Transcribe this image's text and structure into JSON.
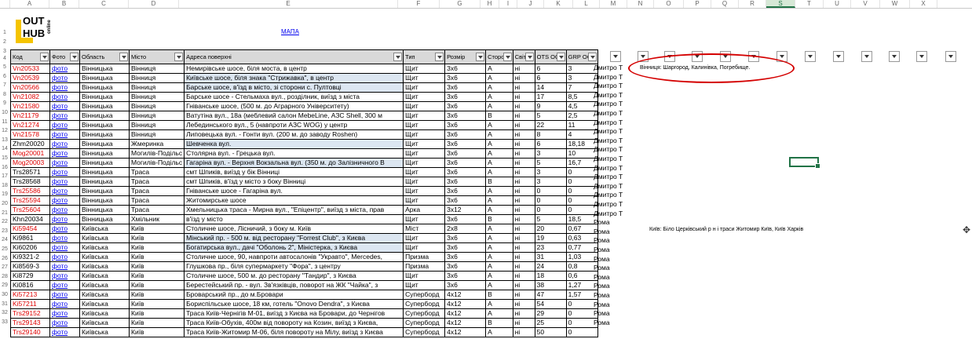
{
  "columns": [
    "A",
    "B",
    "C",
    "D",
    "E",
    "F",
    "G",
    "H",
    "I",
    "J",
    "K",
    "L",
    "M",
    "N",
    "O",
    "P",
    "Q",
    "R",
    "S",
    "T",
    "U",
    "V",
    "W",
    "X"
  ],
  "selected_column": "S",
  "logo": {
    "line1": "OUT",
    "line2": "HUB",
    "line3": "online"
  },
  "mapa_link": "МАПА",
  "headers": [
    "Код",
    "Фото",
    "Область",
    "Місто",
    "Адреса поверхні",
    "Тип",
    "Розмір",
    "Сторона",
    "Світло",
    "OTS OOO",
    "GRP OOO"
  ],
  "rows": [
    {
      "n": "5",
      "code": "Vn20533",
      "red": true,
      "photo": "фото",
      "oblast": "Вінницька",
      "city": "Вінниця",
      "addr": "Немирівське шосе, біля моста, в центр",
      "hl": false,
      "type": "Щит",
      "size": "3х6",
      "side": "A",
      "light": "ні",
      "ots": "6",
      "grp": "3",
      "extra": "Дмитро Т"
    },
    {
      "n": "6",
      "code": "Vn20539",
      "red": true,
      "photo": "фото",
      "oblast": "Вінницька",
      "city": "Вінниця",
      "addr": "Київське шосе, біля знака \"Стрижавка\", в центр",
      "hl": true,
      "type": "Щит",
      "size": "3х6",
      "side": "A",
      "light": "ні",
      "ots": "6",
      "grp": "3",
      "extra": "Дмитро Т"
    },
    {
      "n": "7",
      "code": "Vn20566",
      "red": true,
      "photo": "фото",
      "oblast": "Вінницька",
      "city": "Вінниця",
      "addr": "Барське шосе, в'їзд в місто, зі сторони с. Пултовці",
      "hl": true,
      "type": "Щит",
      "size": "3х6",
      "side": "A",
      "light": "ні",
      "ots": "14",
      "grp": "7",
      "extra": "Дмитро Т"
    },
    {
      "n": "8",
      "code": "Vn21082",
      "red": true,
      "photo": "фото",
      "oblast": "Вінницька",
      "city": "Вінниця",
      "addr": "Барське шосе - Стельмаха вул., розділник, виїзд з міста",
      "hl": false,
      "type": "Щит",
      "size": "3х6",
      "side": "A",
      "light": "ні",
      "ots": "17",
      "grp": "8,5",
      "extra": "Дмитро Т"
    },
    {
      "n": "9",
      "code": "Vn21580",
      "red": true,
      "photo": "фото",
      "oblast": "Вінницька",
      "city": "Вінниця",
      "addr": "Гніванське шосе, (500 м. до Аграрного Університету)",
      "hl": false,
      "type": "Щит",
      "size": "3х6",
      "side": "A",
      "light": "ні",
      "ots": "9",
      "grp": "4,5",
      "extra": "Дмитро Т"
    },
    {
      "n": "10",
      "code": "Vn21179",
      "red": true,
      "photo": "фото",
      "oblast": "Вінницька",
      "city": "Вінниця",
      "addr": "Ватутіна вул., 18а (меблевий салон MebeLine, АЗС Shell, 300 м",
      "hl": false,
      "type": "Щит",
      "size": "3х6",
      "side": "B",
      "light": "ні",
      "ots": "5",
      "grp": "2,5",
      "extra": "Дмитро Т"
    },
    {
      "n": "11",
      "code": "Vn21274",
      "red": true,
      "photo": "фото",
      "oblast": "Вінницька",
      "city": "Вінниця",
      "addr": "Лебединського вул., 5 (навпроти АЗС WOG) у центр",
      "hl": false,
      "type": "Щит",
      "size": "3х6",
      "side": "A",
      "light": "ні",
      "ots": "22",
      "grp": "11",
      "extra": "Дмитро Т"
    },
    {
      "n": "12",
      "code": "Vn21578",
      "red": true,
      "photo": "фото",
      "oblast": "Вінницька",
      "city": "Вінниця",
      "addr": "Липовецька вул. - Гонти вул. (200 м. до заводу Roshen)",
      "hl": false,
      "type": "Щит",
      "size": "3х6",
      "side": "A",
      "light": "ні",
      "ots": "8",
      "grp": "4",
      "extra": "Дмитро Т"
    },
    {
      "n": "13",
      "code": "Zhm20020",
      "red": false,
      "photo": "фото",
      "oblast": "Вінницька",
      "city": "Жмеринка",
      "addr": "Шевченка вул.",
      "hl": true,
      "type": "Щит",
      "size": "3х6",
      "side": "A",
      "light": "ні",
      "ots": "6",
      "grp": "18,18",
      "extra": "Дмитро Т"
    },
    {
      "n": "14",
      "code": "Mog20001",
      "red": true,
      "photo": "фото",
      "oblast": "Вінницька",
      "city": "Могилів-Подільс",
      "addr": "Столярна вул. - Грецька вул.",
      "hl": false,
      "type": "Щит",
      "size": "3х6",
      "side": "A",
      "light": "ні",
      "ots": "3",
      "grp": "10",
      "extra": "Дмитро Т"
    },
    {
      "n": "15",
      "code": "Mog20003",
      "red": true,
      "photo": "фото",
      "oblast": "Вінницька",
      "city": "Могилів-Подільс",
      "addr": "Гагаріна вул. - Верхня Вокзальна вул. (350 м. до Залізничного В",
      "hl": true,
      "type": "Щит",
      "size": "3х6",
      "side": "A",
      "light": "ні",
      "ots": "5",
      "grp": "16,7",
      "extra": "Дмитро Т"
    },
    {
      "n": "16",
      "code": "Trs28571",
      "red": false,
      "photo": "фото",
      "oblast": "Вінницька",
      "city": "Траса",
      "addr": "смт Шпиків, виїзд у бік Вінниці",
      "hl": false,
      "type": "Щит",
      "size": "3х6",
      "side": "A",
      "light": "ні",
      "ots": "3",
      "grp": "0",
      "extra": "Дмитро Т"
    },
    {
      "n": "17",
      "code": "Trs28568",
      "red": false,
      "photo": "фото",
      "oblast": "Вінницька",
      "city": "Траса",
      "addr": "смт Шпиків, в'їзд у місто з боку Вінниці",
      "hl": false,
      "type": "Щит",
      "size": "3х6",
      "side": "B",
      "light": "ні",
      "ots": "3",
      "grp": "0",
      "extra": "Дмитро Т"
    },
    {
      "n": "18",
      "code": "Trs25586",
      "red": true,
      "photo": "фото",
      "oblast": "Вінницька",
      "city": "Траса",
      "addr": "Гніванське шосе - Гагаріна вул.",
      "hl": false,
      "type": "Щит",
      "size": "3х6",
      "side": "A",
      "light": "ні",
      "ots": "0",
      "grp": "0",
      "extra": "Дмитро Т"
    },
    {
      "n": "19",
      "code": "Trs25594",
      "red": true,
      "photo": "фото",
      "oblast": "Вінницька",
      "city": "Траса",
      "addr": "Житомирське шосе",
      "hl": false,
      "type": "Щит",
      "size": "3х6",
      "side": "A",
      "light": "ні",
      "ots": "0",
      "grp": "0",
      "extra": "Дмитро Т"
    },
    {
      "n": "20",
      "code": "Trs25604",
      "red": true,
      "photo": "фото",
      "oblast": "Вінницька",
      "city": "Траса",
      "addr": "Хмельницька траса - Мирна вул., \"Епіцентр\", виїзд з міста, прав",
      "hl": false,
      "type": "Арка",
      "size": "3х12",
      "side": "A",
      "light": "ні",
      "ots": "0",
      "grp": "0",
      "extra": "Дмитро Т"
    },
    {
      "n": "21",
      "code": "Khn20034",
      "red": false,
      "photo": "фото",
      "oblast": "Вінницька",
      "city": "Хмільник",
      "addr": "в'їзд у місто",
      "hl": false,
      "type": "Щит",
      "size": "3х6",
      "side": "B",
      "light": "ні",
      "ots": "5",
      "grp": "18,5",
      "extra": "Дмитро Т"
    },
    {
      "n": "22",
      "code": "Ki59454",
      "red": true,
      "photo": "фото",
      "oblast": "Київська",
      "city": "Київ",
      "addr": "Столичне шосе, Лісничий, з боку м. Київ",
      "hl": false,
      "type": "Міст",
      "size": "2х8",
      "side": "A",
      "light": "ні",
      "ots": "20",
      "grp": "0,67",
      "extra": "Рома"
    },
    {
      "n": "23",
      "code": "Ki9861",
      "red": false,
      "photo": "фото",
      "oblast": "Київська",
      "city": "Київ",
      "addr": "Мінський пр. - 500 м. від ресторану \"Forrest Club\", з Києва",
      "hl": true,
      "type": "Щит",
      "size": "3х6",
      "side": "A",
      "light": "ні",
      "ots": "19",
      "grp": "0,63",
      "extra": "Рома"
    },
    {
      "n": "24",
      "code": "Ki60206",
      "red": false,
      "photo": "фото",
      "oblast": "Київська",
      "city": "Київ",
      "addr": "Богатирська вул., дачі \"Оболонь 2\", Міністерка, з Києва",
      "hl": true,
      "type": "Щит",
      "size": "3х6",
      "side": "A",
      "light": "ні",
      "ots": "23",
      "grp": "0,77",
      "extra": "Рома"
    },
    {
      "n": "25",
      "code": "Ki9321-2",
      "red": false,
      "photo": "фото",
      "oblast": "Київська",
      "city": "Київ",
      "addr": "Столичне шосе, 90, навпроти автосалонів \"Укравто\", Mercedes,",
      "hl": false,
      "type": "Призма",
      "size": "3х6",
      "side": "A",
      "light": "ні",
      "ots": "31",
      "grp": "1,03",
      "extra": "Рома"
    },
    {
      "n": "26",
      "code": "Ki8569-3",
      "red": false,
      "photo": "фото",
      "oblast": "Київська",
      "city": "Київ",
      "addr": "Глушкова пр., біля супермаркету \"Фора\", з центру",
      "hl": false,
      "type": "Призма",
      "size": "3х6",
      "side": "A",
      "light": "ні",
      "ots": "24",
      "grp": "0,8",
      "extra": "Рома"
    },
    {
      "n": "27",
      "code": "Ki8729",
      "red": false,
      "photo": "фото",
      "oblast": "Київська",
      "city": "Київ",
      "addr": "Столичне шосе, 500 м. до ресторану \"Тандир\", з Києва",
      "hl": false,
      "type": "Щит",
      "size": "3х6",
      "side": "A",
      "light": "ні",
      "ots": "18",
      "grp": "0,6",
      "extra": "Рома"
    },
    {
      "n": "28",
      "code": "Ki0816",
      "red": false,
      "photo": "фото",
      "oblast": "Київська",
      "city": "Київ",
      "addr": "Берестейський пр. - вул. Зв'язківців, поворот на ЖК \"Чайка\", з",
      "hl": false,
      "type": "Щит",
      "size": "3х6",
      "side": "A",
      "light": "ні",
      "ots": "38",
      "grp": "1,27",
      "extra": "Рома"
    },
    {
      "n": "29",
      "code": "Ki57213",
      "red": true,
      "photo": "фото",
      "oblast": "Київська",
      "city": "Київ",
      "addr": "Броварський пр., до м.Бровари",
      "hl": false,
      "type": "Суперборд",
      "size": "4х12",
      "side": "B",
      "light": "ні",
      "ots": "47",
      "grp": "1,57",
      "extra": "Рома"
    },
    {
      "n": "30",
      "code": "Ki57211",
      "red": true,
      "photo": "фото",
      "oblast": "Київська",
      "city": "Київ",
      "addr": "Бориспільське шосе, 18 км, готель \"Onovo Dendra\", з Києва",
      "hl": false,
      "type": "Суперборд",
      "size": "4х12",
      "side": "A",
      "light": "ні",
      "ots": "54",
      "grp": "0",
      "extra": "Рома"
    },
    {
      "n": "31",
      "code": "Trs29152",
      "red": true,
      "photo": "фото",
      "oblast": "Київська",
      "city": "Київ",
      "addr": "Траса Київ-Чернігів М-01, виїзд з Києва на Бровари, до Чернігов",
      "hl": false,
      "type": "Суперборд",
      "size": "4х12",
      "side": "A",
      "light": "ні",
      "ots": "29",
      "grp": "0",
      "extra": "Рома"
    },
    {
      "n": "32",
      "code": "Trs29143",
      "red": true,
      "photo": "фото",
      "oblast": "Київська",
      "city": "Київ",
      "addr": "Траса Київ-Обухів, 400м від повороту на Козин, виїзд з Києва,",
      "hl": false,
      "type": "Суперборд",
      "size": "4х12",
      "side": "B",
      "light": "ні",
      "ots": "25",
      "grp": "0",
      "extra": "Рома"
    },
    {
      "n": "33",
      "code": "Trs29140",
      "red": true,
      "photo": "фото",
      "oblast": "Київська",
      "city": "Київ",
      "addr": "Траса Київ-Житомир М-06, біля повороту на Мілу, виїзд з Києва",
      "hl": false,
      "type": "Суперборд",
      "size": "4х12",
      "side": "A",
      "light": "ні",
      "ots": "50",
      "grp": "0",
      "extra": "Рома"
    }
  ],
  "note_vinnytsia": "Вінниця: Шаргород, Калинівка, Погребище.",
  "note_kyiv": "Київ: Біло Церківський р н і траси Житомир Київ, Київ Харків",
  "colors": {
    "oval": "#d40000",
    "active": "#217346",
    "header": "#d9d9d9",
    "highlight": "#dce6f1",
    "link": "#0000ee",
    "red_code": "#e00000"
  }
}
